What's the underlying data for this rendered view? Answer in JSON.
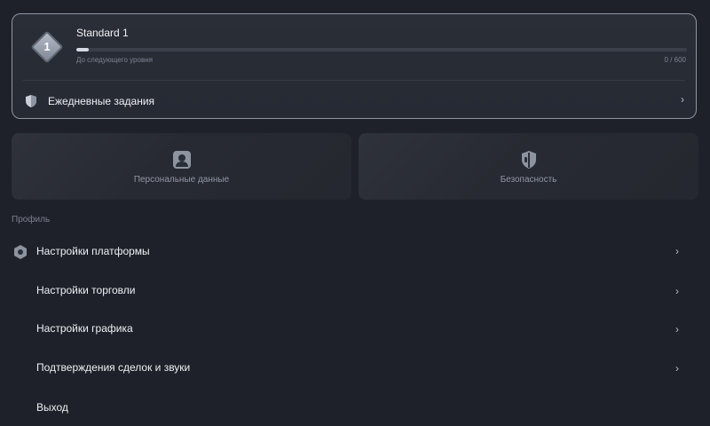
{
  "level": {
    "badge_number": "1",
    "name": "Standard 1",
    "progress_caption": "До следующего уровня",
    "progress_count": "0 / 600",
    "progress_fraction": 0.02,
    "daily_tasks_label": "Ежедневные задания",
    "chevron": "›"
  },
  "tiles": [
    {
      "label": "Персональные данные",
      "icon": "person-icon"
    },
    {
      "label": "Безопасность",
      "icon": "shield-icon"
    }
  ],
  "profile_section": {
    "title": "Профиль",
    "items": [
      {
        "label": "Настройки платформы",
        "icon": "hexagon-icon",
        "chevron": "›"
      },
      {
        "label": "Настройки торговли",
        "chevron": "›"
      },
      {
        "label": "Настройки графика",
        "chevron": "›"
      },
      {
        "label": "Подтверждения сделок и звуки",
        "chevron": "›"
      },
      {
        "label": "Выход"
      }
    ]
  },
  "colors": {
    "background": "#1e2129",
    "card_border": "#8f96a3",
    "progress_fill": "#d6dae2"
  }
}
